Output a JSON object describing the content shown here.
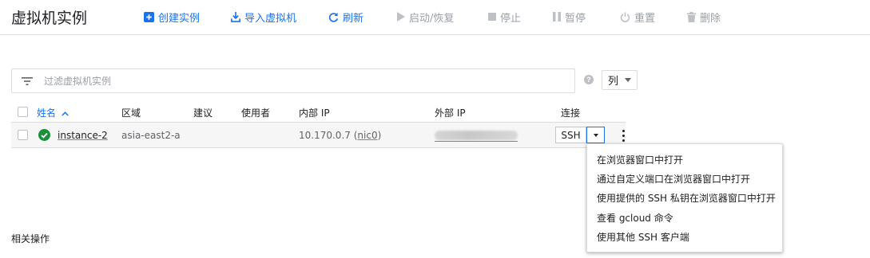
{
  "header": {
    "title": "虚拟机实例",
    "toolbar": [
      {
        "label": "创建实例",
        "icon": "add-box-icon",
        "enabled": true
      },
      {
        "label": "导入虚拟机",
        "icon": "import-icon",
        "enabled": true
      },
      {
        "label": "刷新",
        "icon": "refresh-icon",
        "enabled": true
      },
      {
        "label": "启动/恢复",
        "icon": "play-icon",
        "enabled": false
      },
      {
        "label": "停止",
        "icon": "stop-icon",
        "enabled": false
      },
      {
        "label": "暂停",
        "icon": "pause-icon",
        "enabled": false
      },
      {
        "label": "重置",
        "icon": "power-icon",
        "enabled": false
      },
      {
        "label": "删除",
        "icon": "trash-icon",
        "enabled": false
      }
    ]
  },
  "filter": {
    "placeholder": "过滤虚拟机实例",
    "help_glyph": "?",
    "columns_label": "列"
  },
  "table": {
    "columns": {
      "name": "姓名",
      "zone": "区域",
      "recommendation": "建议",
      "in_use_by": "使用者",
      "internal_ip": "内部 IP",
      "external_ip": "外部 IP",
      "connect": "连接"
    },
    "sort_indicator": "^",
    "rows": [
      {
        "status": "running",
        "name": "instance-2",
        "zone": "asia-east2-a",
        "internal_ip_value": "10.170.0.7",
        "nic_prefix": "(",
        "nic": "nic0",
        "nic_suffix": ")",
        "external_ip": "redacted",
        "connect_label": "SSH"
      }
    ]
  },
  "ssh_menu": [
    "在浏览器窗口中打开",
    "通过自定义端口在浏览器窗口中打开",
    "使用提供的 SSH 私钥在浏览器窗口中打开",
    "查看 gcloud 命令",
    "使用其他 SSH 客户端"
  ],
  "related": {
    "title": "相关操作"
  },
  "colors": {
    "accent": "#1a73e8",
    "disabled": "#9aa0a6",
    "status_ok": "#1e8e3e",
    "border": "#dadce0"
  }
}
